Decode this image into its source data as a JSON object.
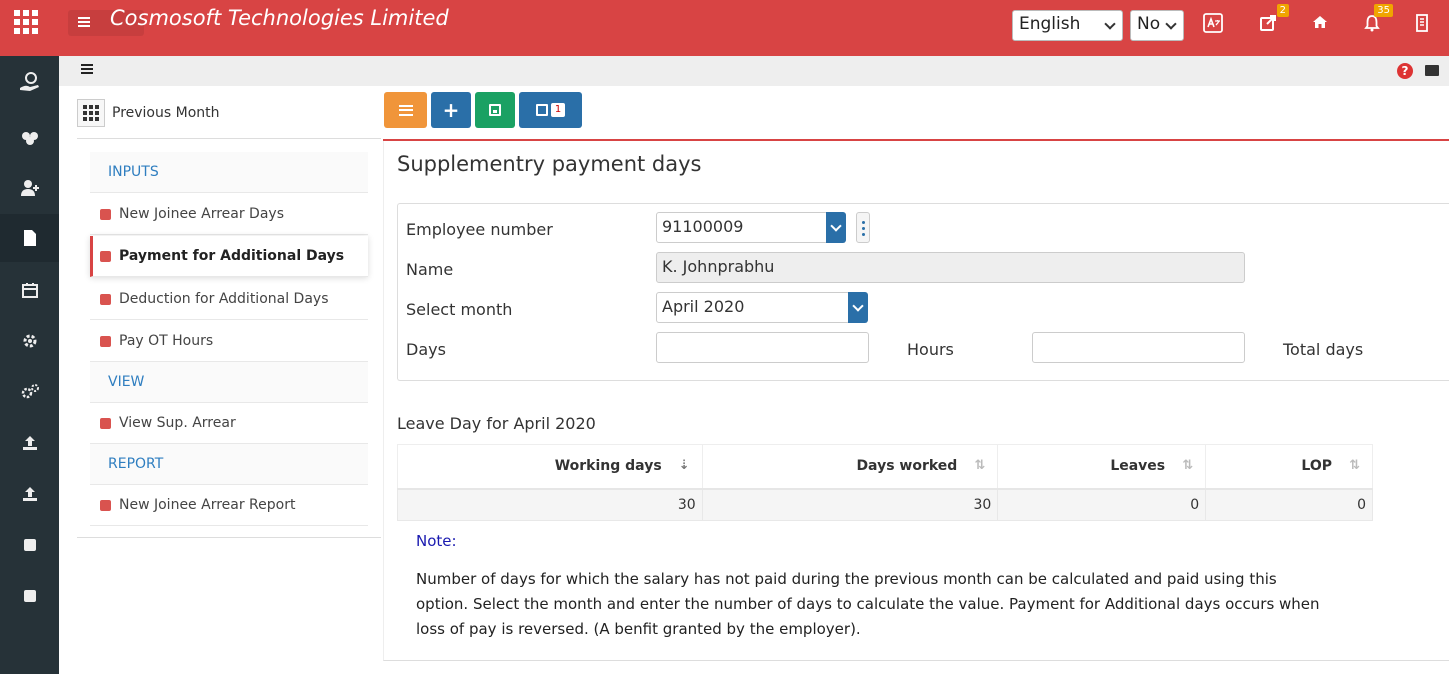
{
  "header": {
    "brand": "Cosmosoft Technologies Limited",
    "language": "English",
    "option": "No",
    "tasks_badge": "2",
    "notifications_badge": "35"
  },
  "module_nav": {
    "previous_month": "Previous Month",
    "inputs_heading": "INPUTS",
    "new_joinee_arrear_days": "New Joinee Arrear Days",
    "payment_for_additional_days": "Payment for Additional Days",
    "deduction_for_additional_days": "Deduction for Additional Days",
    "pay_ot_hours": "Pay OT Hours",
    "view_heading": "VIEW",
    "view_sup_arrear": "View Sup. Arrear",
    "report_heading": "REPORT",
    "new_joinee_arrear_report": "New Joinee Arrear Report"
  },
  "toolbar": {
    "export_badge": "1"
  },
  "form": {
    "title": "Supplementry payment days",
    "employee_number_label": "Employee number",
    "employee_number": "91100009",
    "name_label": "Name",
    "name": "K. Johnprabhu",
    "select_month_label": "Select month",
    "select_month": "April 2020",
    "days_label": "Days",
    "days": "",
    "hours_label": "Hours",
    "hours": "",
    "total_days_label": "Total days"
  },
  "leave_table": {
    "title": "Leave Day for April 2020",
    "columns": [
      "Working days",
      "Days worked",
      "Leaves",
      "LOP"
    ],
    "rows": [
      [
        "30",
        "30",
        "0",
        "0"
      ]
    ]
  },
  "note": {
    "label": "Note:",
    "text": "Number of days for which the salary has not paid during the previous month can be calculated and paid using this option. Select the month and enter the number of days to calculate the value. Payment for Additional days occurs when loss of pay is reversed. (A benfit granted by the employer)."
  }
}
